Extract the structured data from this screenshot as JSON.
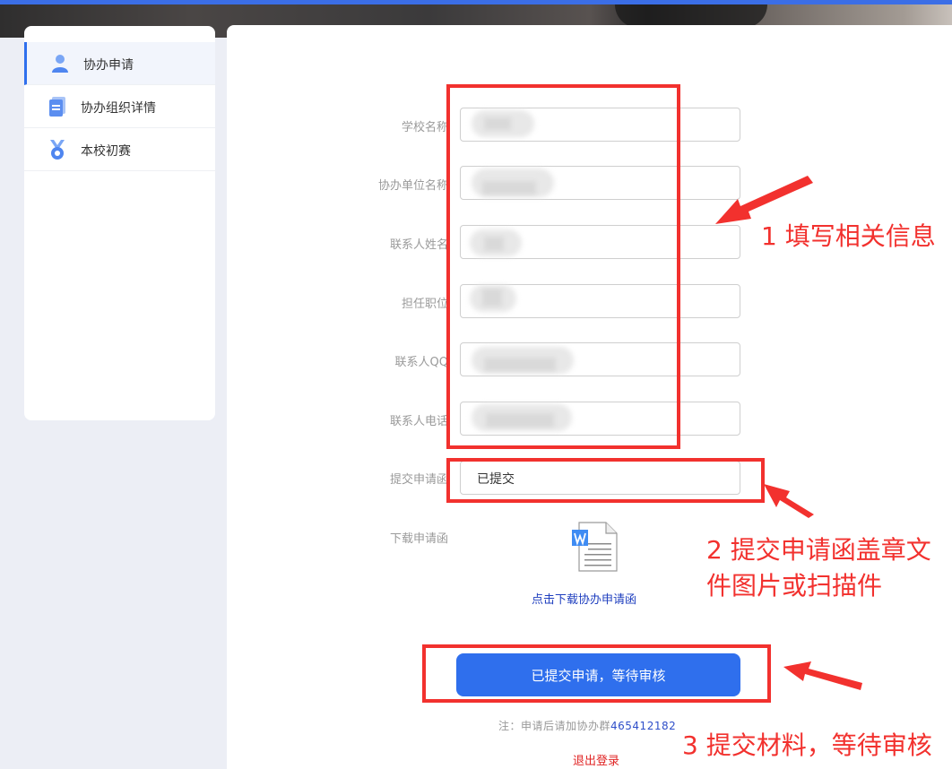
{
  "sidebar": {
    "items": [
      {
        "label": "协办申请",
        "icon": "user-icon",
        "active": true
      },
      {
        "label": "协办组织详情",
        "icon": "document-icon",
        "active": false
      },
      {
        "label": "本校初赛",
        "icon": "medal-icon",
        "active": false
      }
    ]
  },
  "form": {
    "fields": [
      {
        "label": "学校名称",
        "value": ""
      },
      {
        "label": "协办单位名称",
        "value": ""
      },
      {
        "label": "联系人姓名",
        "value": ""
      },
      {
        "label": "担任职位",
        "value": ""
      },
      {
        "label": "联系人QQ",
        "value": ""
      },
      {
        "label": "联系人电话",
        "value": ""
      },
      {
        "label": "提交申请函",
        "value": "已提交"
      }
    ],
    "download": {
      "label": "下载申请函",
      "icon": "word-document-icon",
      "link_text": "点击下载协办申请函"
    },
    "submit_label": "已提交申请，等待审核",
    "note_prefix": "注：申请后请加协办群",
    "note_qq": "465412182",
    "logout_label": "退出登录"
  },
  "annotations": {
    "step1": "1 填写相关信息",
    "step2_line1": "2 提交申请函盖章文",
    "step2_line2": "件图片或扫描件",
    "step3": "3 提交材料，等待审核"
  },
  "colors": {
    "accent": "#2f6fed",
    "annotation_red": "#f2312e",
    "logout_red": "#e02424"
  }
}
